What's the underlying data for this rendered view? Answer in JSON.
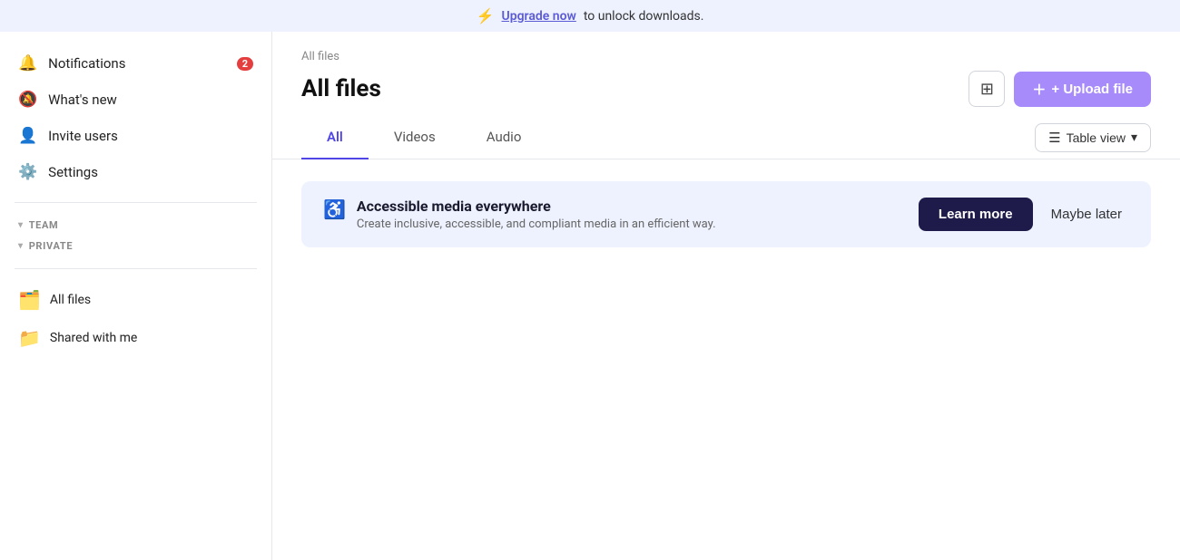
{
  "banner": {
    "bolt_icon": "⚡",
    "text": "to unlock downloads.",
    "link_text": "Upgrade now"
  },
  "sidebar": {
    "notifications_label": "Notifications",
    "notifications_badge": "2",
    "whats_new_label": "What's new",
    "invite_users_label": "Invite users",
    "settings_label": "Settings",
    "section_team": "TEAM",
    "section_private": "PRIVATE",
    "all_files_label": "All files",
    "shared_with_me_label": "Shared with me"
  },
  "content": {
    "breadcrumb": "All files",
    "page_title": "All files",
    "add_to_folder_label": "＋",
    "upload_button_label": "+ Upload file",
    "tabs": [
      {
        "label": "All",
        "active": true
      },
      {
        "label": "Videos",
        "active": false
      },
      {
        "label": "Audio",
        "active": false
      }
    ],
    "view_toggle_label": "Table view"
  },
  "info_card": {
    "icon": "♿",
    "title": "Accessible media everywhere",
    "subtitle": "Create inclusive, accessible, and compliant media in an efficient way.",
    "learn_more_label": "Learn more",
    "maybe_later_label": "Maybe later"
  }
}
